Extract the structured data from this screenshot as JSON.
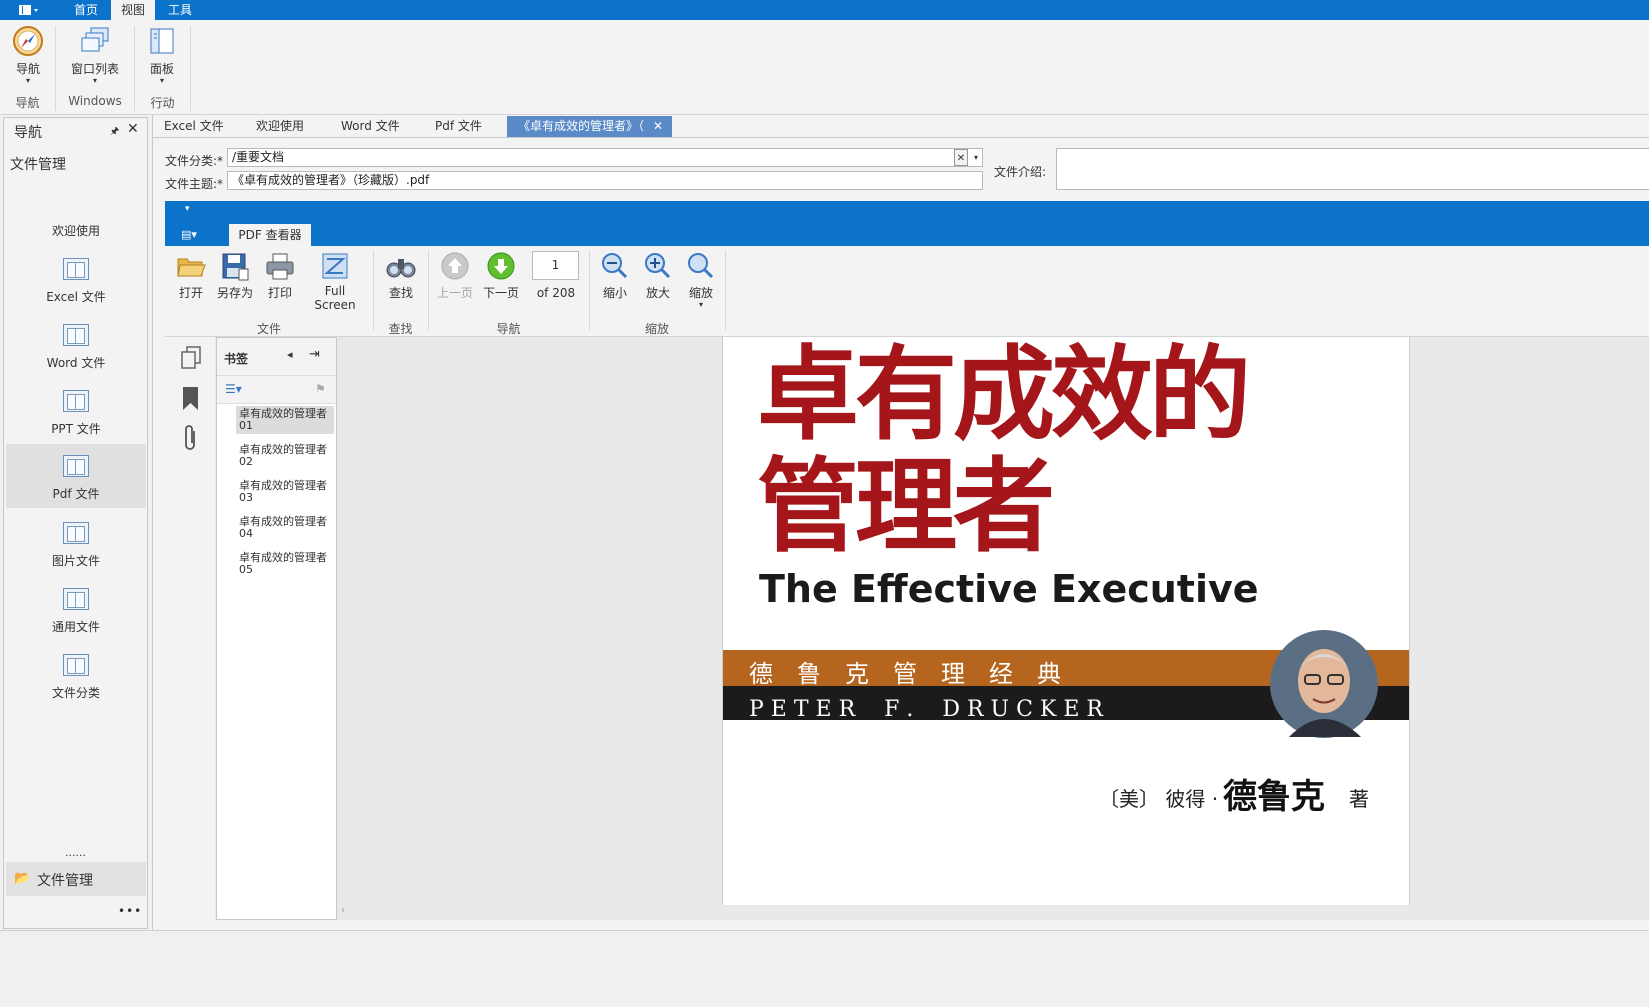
{
  "menu": {
    "app_icon": "layout-icon",
    "tabs": [
      "首页",
      "视图",
      "工具"
    ]
  },
  "ribbon": {
    "nav_label": "导航",
    "windows_list_label": "窗口列表",
    "panel_label": "面板",
    "groups": [
      "导航",
      "Windows",
      "行动"
    ]
  },
  "nav": {
    "title": "导航",
    "section": "文件管理",
    "items": [
      "欢迎使用",
      "Excel 文件",
      "Word 文件",
      "PPT 文件",
      "Pdf 文件",
      "图片文件",
      "通用文件",
      "文件分类"
    ],
    "more": "......",
    "footer_item": "文件管理",
    "footer_more": "•••"
  },
  "doc_tabs": [
    "Excel 文件",
    "欢迎使用",
    "Word 文件",
    "Pdf 文件",
    "《卓有成效的管理者》（"
  ],
  "form": {
    "category_label": "文件分类:*",
    "category_value": "/重要文档",
    "subject_label": "文件主题:*",
    "subject_value": "《卓有成效的管理者》（珍藏版）.pdf",
    "intro_label": "文件介绍:"
  },
  "pdf": {
    "tab_label": "PDF 查看器",
    "buttons": {
      "open": "打开",
      "save_as": "另存为",
      "print": "打印",
      "fullscreen": "Full Screen",
      "find": "查找",
      "prev": "上一页",
      "next": "下一页",
      "page_value": "1",
      "page_of": "of 208",
      "zoom_out": "缩小",
      "zoom_in": "放大",
      "zoom": "缩放"
    },
    "groups": [
      "文件",
      "查找",
      "导航",
      "缩放"
    ],
    "bookmarks_title": "书签",
    "bookmarks": [
      {
        "line1": "卓有成效的管理者",
        "line2": "01"
      },
      {
        "line1": "卓有成效的管理者",
        "line2": "02"
      },
      {
        "line1": "卓有成效的管理者",
        "line2": "03"
      },
      {
        "line1": "卓有成效的管理者",
        "line2": "04"
      },
      {
        "line1": "卓有成效的管理者",
        "line2": "05"
      }
    ],
    "cover": {
      "title_line1": "卓有成效的",
      "title_line2": "管理者",
      "english": "The Effective Executive",
      "band_cn": "德　鲁　克　管　理　经　典",
      "band_en": "P E T E R　 F .　 D R U C K E R",
      "author_prefix": "〔美〕 彼得 ·",
      "author_name": "德鲁克",
      "author_suffix": "著"
    }
  },
  "colors": {
    "accent": "#0b73c9",
    "cover_red": "#a4161a",
    "band_orange": "#b5651d",
    "band_dark": "#1b1b1b"
  }
}
